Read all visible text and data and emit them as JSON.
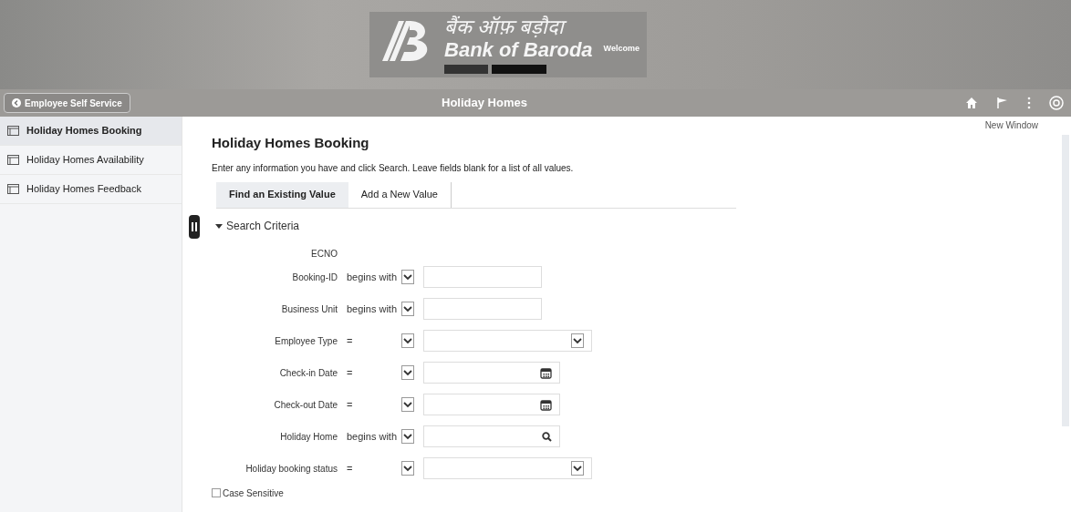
{
  "header": {
    "logo_hindi": "बैंक ऑफ़ बड़ौदा",
    "logo_english": "Bank of Baroda",
    "welcome": "Welcome"
  },
  "navbar": {
    "back_button": "Employee Self Service",
    "title": "Holiday Homes"
  },
  "sidebar": {
    "items": [
      {
        "label": "Holiday Homes Booking",
        "selected": true
      },
      {
        "label": "Holiday Homes Availability",
        "selected": false
      },
      {
        "label": "Holiday Homes Feedback",
        "selected": false
      }
    ]
  },
  "page": {
    "new_window": "New Window",
    "title": "Holiday Homes Booking",
    "instructions": "Enter any information you have and click Search. Leave fields blank for a list of all values.",
    "tabs": [
      {
        "label": "Find an Existing Value",
        "selected": true
      },
      {
        "label": "Add a New Value",
        "selected": false
      }
    ],
    "section": {
      "title": "Search Criteria",
      "expanded": true
    },
    "criteria": [
      {
        "kind": "label",
        "label": "ECNO"
      },
      {
        "kind": "text",
        "label": "Booking-ID",
        "operator": "begins with"
      },
      {
        "kind": "text",
        "label": "Business Unit",
        "operator": "begins with"
      },
      {
        "kind": "select",
        "label": "Employee Type",
        "operator": "="
      },
      {
        "kind": "date",
        "label": "Check-in Date",
        "operator": "="
      },
      {
        "kind": "date",
        "label": "Check-out Date",
        "operator": "="
      },
      {
        "kind": "lookup",
        "label": "Holiday Home",
        "operator": "begins with"
      },
      {
        "kind": "select",
        "label": "Holiday booking status",
        "operator": "="
      }
    ],
    "case_sensitive": {
      "label": "Case Sensitive",
      "checked": false
    }
  }
}
